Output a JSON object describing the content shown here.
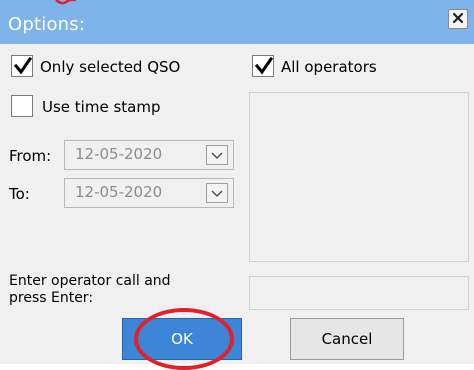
{
  "window": {
    "title": "Options:"
  },
  "options": {
    "only_selected_qso": {
      "label": "Only selected QSO",
      "checked": true
    },
    "all_operators": {
      "label": "All operators",
      "checked": true
    },
    "use_time_stamp": {
      "label": "Use time stamp",
      "checked": false
    }
  },
  "date_range": {
    "from_label": "From:",
    "from_value": "12-05-2020",
    "to_label": "To:",
    "to_value": "12-05-2020"
  },
  "operator_entry": {
    "label_line1": "Enter operator call and",
    "label_line2": "press Enter:",
    "value": ""
  },
  "buttons": {
    "ok_label": "OK",
    "cancel_label": "Cancel"
  },
  "colors": {
    "titlebar": "#7eb4ea",
    "ok_button": "#3d85d6",
    "annotation": "#e0202a"
  }
}
